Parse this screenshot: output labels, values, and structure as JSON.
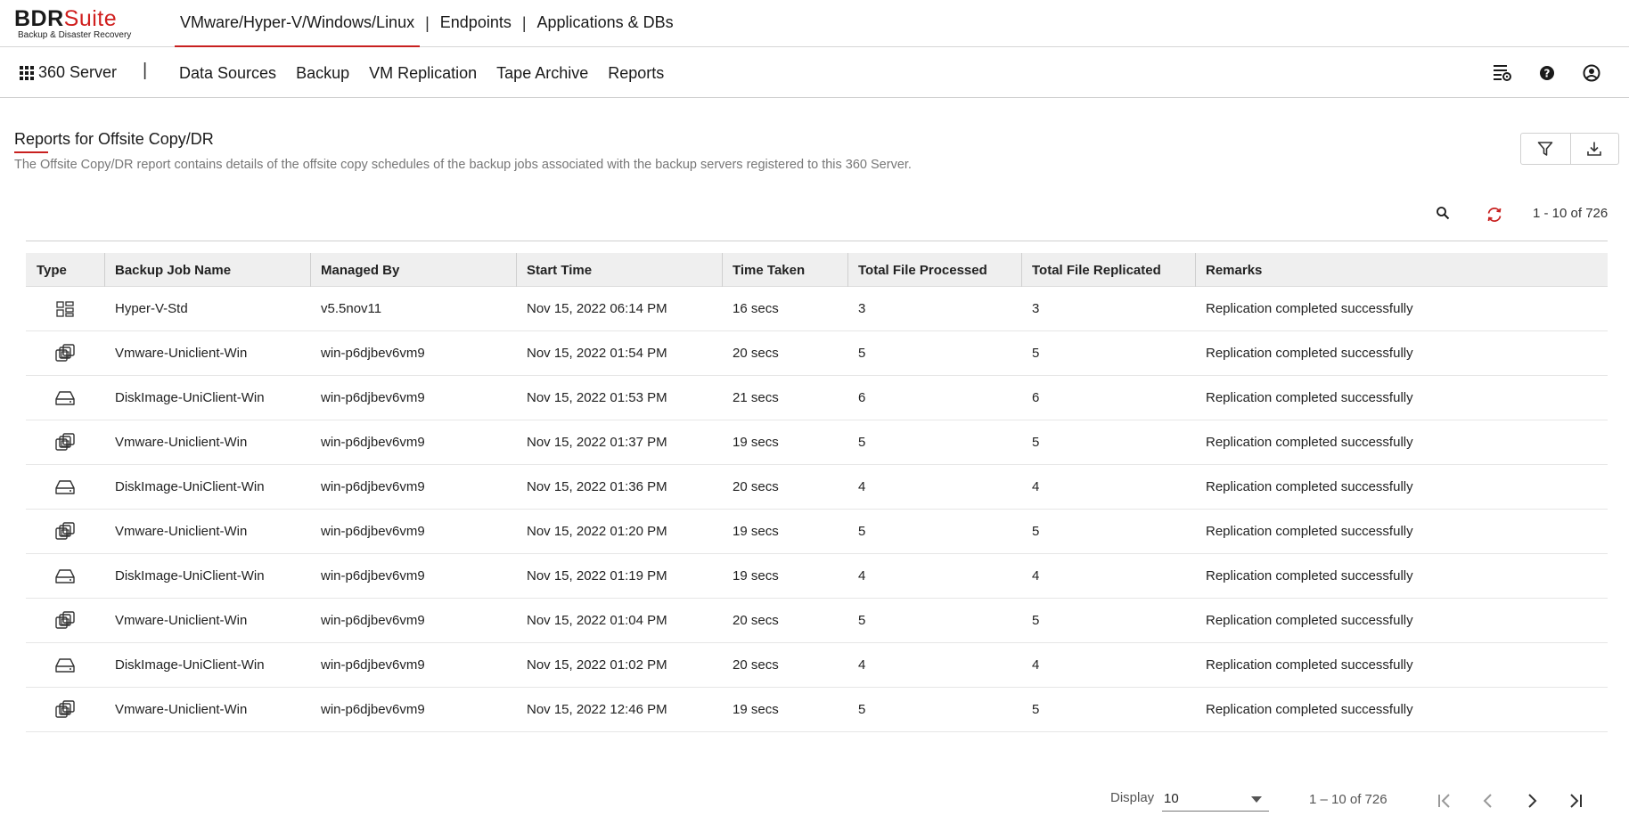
{
  "brand": {
    "name_part1": "BDR",
    "name_part2": "Suite",
    "tagline": "Backup & Disaster Recovery"
  },
  "product_tabs": [
    {
      "label": "VMware/Hyper-V/Windows/Linux",
      "active": true
    },
    {
      "label": "Endpoints",
      "active": false
    },
    {
      "label": "Applications & DBs",
      "active": false
    }
  ],
  "product_separator": "|",
  "nav": {
    "apps_label": "360 Server",
    "separator": "|",
    "items": [
      "Data Sources",
      "Backup",
      "VM Replication",
      "Tape Archive",
      "Reports"
    ],
    "icons": [
      "settings-list-icon",
      "help-icon",
      "user-account-icon"
    ]
  },
  "page": {
    "title": "Reports for Offsite Copy/DR",
    "description": "The Offsite Copy/DR report contains details of the offsite copy schedules of the backup jobs associated with the backup servers registered to this 360 Server.",
    "tools": [
      "filter-icon",
      "download-icon"
    ]
  },
  "table_toolbar": {
    "count_text": "1 - 10 of 726",
    "refresh_color": "#c8201f"
  },
  "table": {
    "columns": [
      "Type",
      "Backup Job Name",
      "Managed By",
      "Start Time",
      "Time Taken",
      "Total File Processed",
      "Total File Replicated",
      "Remarks"
    ],
    "rows": [
      {
        "type": "hyperv-icon",
        "job": "Hyper-V-Std",
        "managed": "v5.5nov11",
        "start": "Nov 15, 2022 06:14 PM",
        "time": "16 secs",
        "processed": "3",
        "replicated": "3",
        "remarks": "Replication completed successfully"
      },
      {
        "type": "vmware-icon",
        "job": "Vmware-Uniclient-Win",
        "managed": "win-p6djbev6vm9",
        "start": "Nov 15, 2022 01:54 PM",
        "time": "20 secs",
        "processed": "5",
        "replicated": "5",
        "remarks": "Replication completed successfully"
      },
      {
        "type": "disk-image-icon",
        "job": "DiskImage-UniClient-Win",
        "managed": "win-p6djbev6vm9",
        "start": "Nov 15, 2022 01:53 PM",
        "time": "21 secs",
        "processed": "6",
        "replicated": "6",
        "remarks": "Replication completed successfully"
      },
      {
        "type": "vmware-icon",
        "job": "Vmware-Uniclient-Win",
        "managed": "win-p6djbev6vm9",
        "start": "Nov 15, 2022 01:37 PM",
        "time": "19 secs",
        "processed": "5",
        "replicated": "5",
        "remarks": "Replication completed successfully"
      },
      {
        "type": "disk-image-icon",
        "job": "DiskImage-UniClient-Win",
        "managed": "win-p6djbev6vm9",
        "start": "Nov 15, 2022 01:36 PM",
        "time": "20 secs",
        "processed": "4",
        "replicated": "4",
        "remarks": "Replication completed successfully"
      },
      {
        "type": "vmware-icon",
        "job": "Vmware-Uniclient-Win",
        "managed": "win-p6djbev6vm9",
        "start": "Nov 15, 2022 01:20 PM",
        "time": "19 secs",
        "processed": "5",
        "replicated": "5",
        "remarks": "Replication completed successfully"
      },
      {
        "type": "disk-image-icon",
        "job": "DiskImage-UniClient-Win",
        "managed": "win-p6djbev6vm9",
        "start": "Nov 15, 2022 01:19 PM",
        "time": "19 secs",
        "processed": "4",
        "replicated": "4",
        "remarks": "Replication completed successfully"
      },
      {
        "type": "vmware-icon",
        "job": "Vmware-Uniclient-Win",
        "managed": "win-p6djbev6vm9",
        "start": "Nov 15, 2022 01:04 PM",
        "time": "20 secs",
        "processed": "5",
        "replicated": "5",
        "remarks": "Replication completed successfully"
      },
      {
        "type": "disk-image-icon",
        "job": "DiskImage-UniClient-Win",
        "managed": "win-p6djbev6vm9",
        "start": "Nov 15, 2022 01:02 PM",
        "time": "20 secs",
        "processed": "4",
        "replicated": "4",
        "remarks": "Replication completed successfully"
      },
      {
        "type": "vmware-icon",
        "job": "Vmware-Uniclient-Win",
        "managed": "win-p6djbev6vm9",
        "start": "Nov 15, 2022 12:46 PM",
        "time": "19 secs",
        "processed": "5",
        "replicated": "5",
        "remarks": "Replication completed successfully"
      }
    ]
  },
  "pagination": {
    "display_label": "Display",
    "page_size": "10",
    "range_text": "1 – 10 of 726",
    "buttons": [
      "first-page-icon",
      "previous-page-icon",
      "next-page-icon",
      "last-page-icon"
    ]
  },
  "colors": {
    "accent": "#c8201f",
    "header_bg": "#efefef",
    "muted_text": "#777777"
  }
}
